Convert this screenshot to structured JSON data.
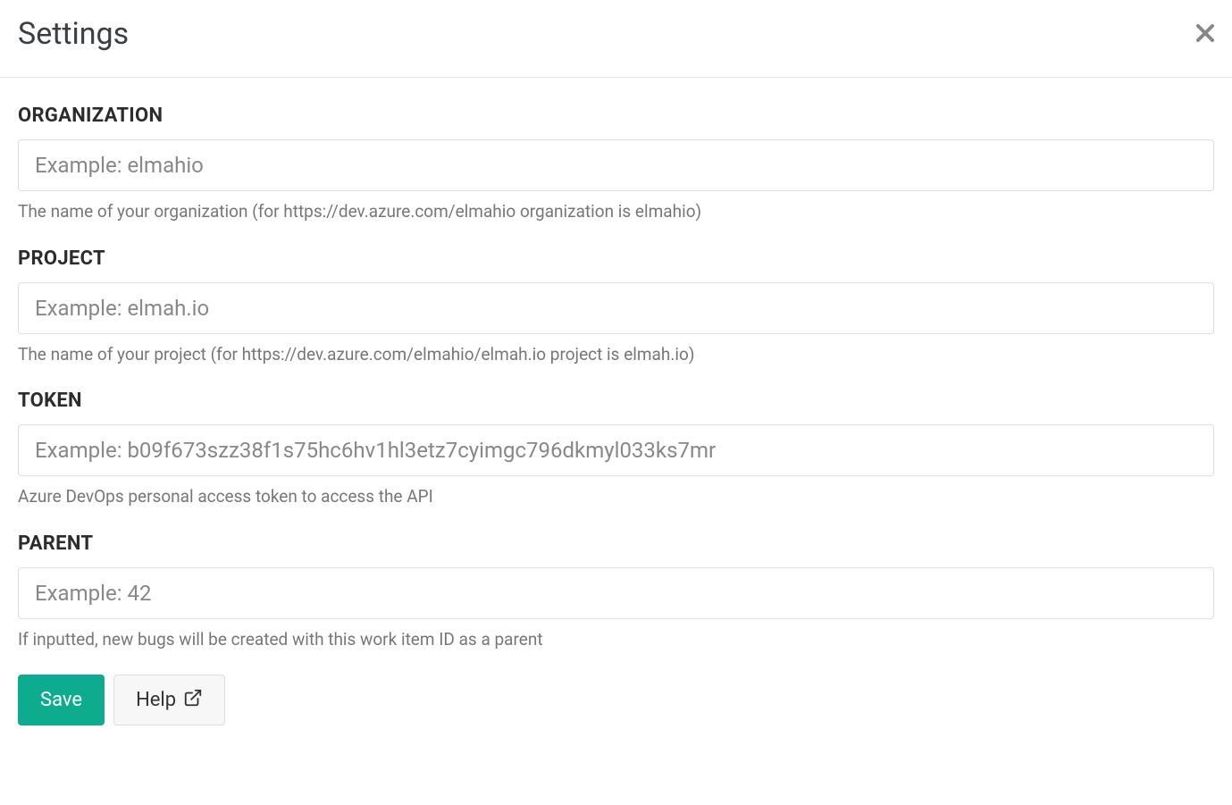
{
  "header": {
    "title": "Settings"
  },
  "form": {
    "organization": {
      "label": "ORGANIZATION",
      "placeholder": "Example: elmahio",
      "value": "",
      "help": "The name of your organization (for https://dev.azure.com/elmahio organization is elmahio)"
    },
    "project": {
      "label": "PROJECT",
      "placeholder": "Example: elmah.io",
      "value": "",
      "help": "The name of your project (for https://dev.azure.com/elmahio/elmah.io project is elmah.io)"
    },
    "token": {
      "label": "TOKEN",
      "placeholder": "Example: b09f673szz38f1s75hc6hv1hl3etz7cyimgc796dkmyl033ks7mr",
      "value": "",
      "help": "Azure DevOps personal access token to access the API"
    },
    "parent": {
      "label": "PARENT",
      "placeholder": "Example: 42",
      "value": "",
      "help": "If inputted, new bugs will be created with this work item ID as a parent"
    }
  },
  "buttons": {
    "save_label": "Save",
    "help_label": "Help"
  }
}
